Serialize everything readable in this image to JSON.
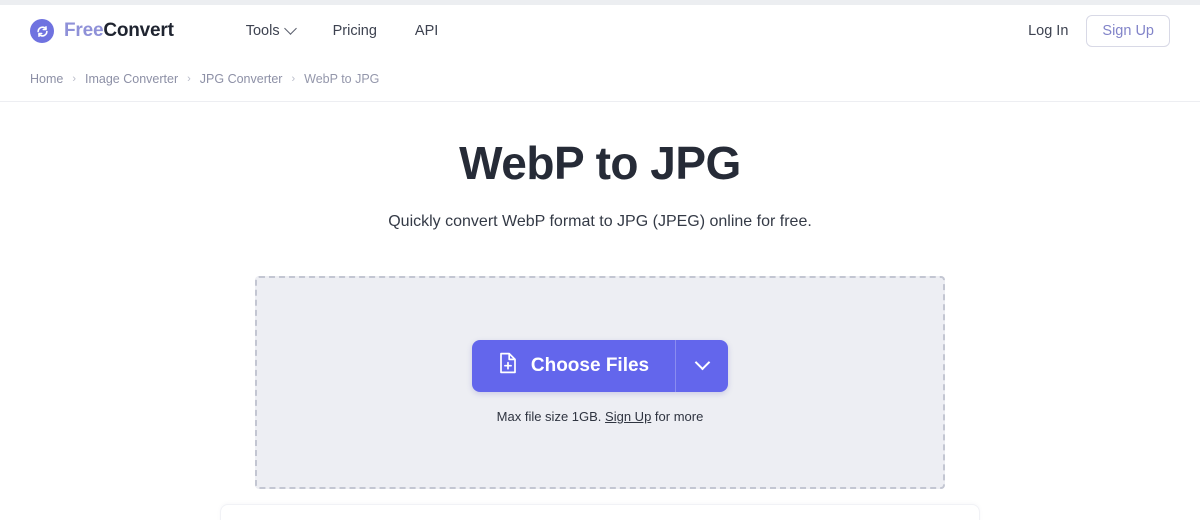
{
  "brand": {
    "logo_icon": "refresh-circle-icon",
    "name_part1": "Free",
    "name_part2": "Convert"
  },
  "header": {
    "nav": [
      {
        "label": "Tools",
        "has_dropdown": true,
        "icon": "chevron-down-icon"
      },
      {
        "label": "Pricing",
        "has_dropdown": false
      },
      {
        "label": "API",
        "has_dropdown": false
      }
    ],
    "login_label": "Log In",
    "signup_label": "Sign Up"
  },
  "breadcrumb": {
    "separator": "›",
    "items": [
      {
        "label": "Home"
      },
      {
        "label": "Image Converter"
      },
      {
        "label": "JPG Converter"
      },
      {
        "label": "WebP to JPG"
      }
    ]
  },
  "main": {
    "title": "WebP to JPG",
    "subtitle": "Quickly convert WebP format to JPG (JPEG) online for free.",
    "dropzone": {
      "choose_files_label": "Choose Files",
      "choose_files_icon": "file-plus-icon",
      "dropdown_icon": "chevron-down-icon",
      "max_size_prefix": "Max file size 1GB.",
      "max_size_link": "Sign Up",
      "max_size_suffix": "for more"
    }
  },
  "colors": {
    "accent": "#6366ec",
    "brand_light": "#8f91d8",
    "brand_dark": "#1f2430",
    "dropzone_bg": "#edeef3",
    "dropzone_border": "#c3c6d2",
    "page_bg": "#ffffff",
    "top_strip": "#eceef1"
  }
}
